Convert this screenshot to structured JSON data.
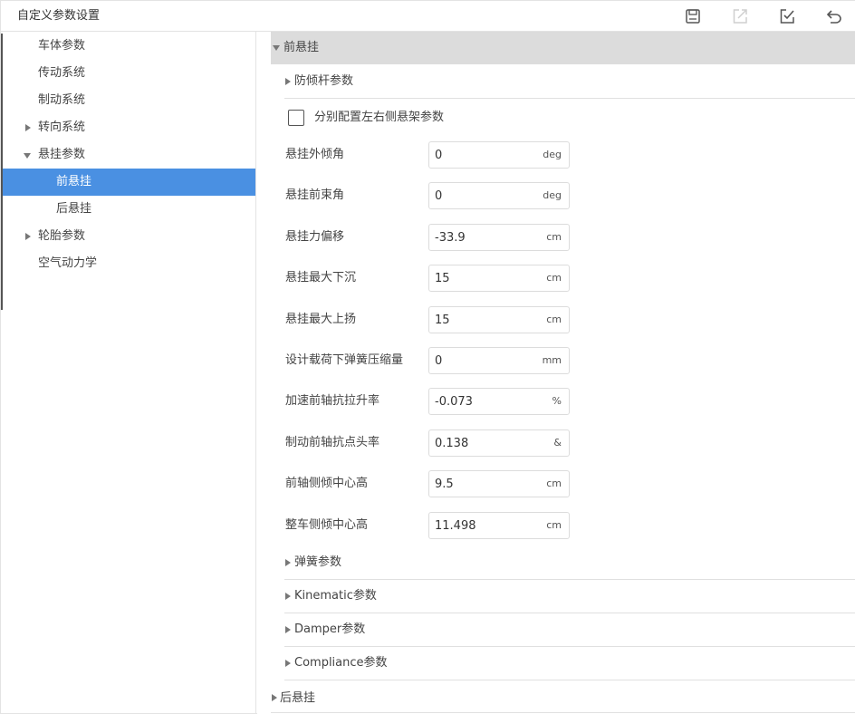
{
  "window": {
    "title": "自定义参数设置",
    "toolbar": [
      "save-icon",
      "export-icon",
      "apply-icon",
      "undo-icon"
    ]
  },
  "sidebar": {
    "items": [
      {
        "label": "车体参数",
        "level": 1,
        "expandable": false
      },
      {
        "label": "传动系统",
        "level": 1,
        "expandable": false
      },
      {
        "label": "制动系统",
        "level": 1,
        "expandable": false
      },
      {
        "label": "转向系统",
        "level": 1,
        "expandable": true,
        "expanded": false
      },
      {
        "label": "悬挂参数",
        "level": 1,
        "expandable": true,
        "expanded": true
      },
      {
        "label": "前悬挂",
        "level": 2,
        "selected": true
      },
      {
        "label": "后悬挂",
        "level": 2
      },
      {
        "label": "轮胎参数",
        "level": 1,
        "expandable": true,
        "expanded": false
      },
      {
        "label": "空气动力学",
        "level": 1,
        "expandable": false
      }
    ],
    "active_color": "#4a90e2"
  },
  "main": {
    "section_title": "前悬挂",
    "anti_roll": "防倾杆参数",
    "checkbox": {
      "label": "分别配置左右侧悬架参数",
      "checked": false
    },
    "params": [
      {
        "label": "悬挂外倾角",
        "value": "0",
        "unit": "deg"
      },
      {
        "label": "悬挂前束角",
        "value": "0",
        "unit": "deg"
      },
      {
        "label": "悬挂力偏移",
        "value": "-33.9",
        "unit": "cm"
      },
      {
        "label": "悬挂最大下沉",
        "value": "15",
        "unit": "cm"
      },
      {
        "label": "悬挂最大上扬",
        "value": "15",
        "unit": "cm"
      },
      {
        "label": "设计载荷下弹簧压缩量",
        "value": "0",
        "unit": "mm"
      },
      {
        "label": "加速前轴抗拉升率",
        "value": "-0.073",
        "unit": "%"
      },
      {
        "label": "制动前轴抗点头率",
        "value": "0.138",
        "unit": "&"
      },
      {
        "label": "前轴侧倾中心高",
        "value": "9.5",
        "unit": "cm"
      },
      {
        "label": "整车侧倾中心高",
        "value": "11.498",
        "unit": "cm"
      }
    ],
    "subsections": [
      "弹簧参数",
      "Kinematic参数",
      "Damper参数",
      "Compliance参数"
    ],
    "next_section": "后悬挂"
  }
}
